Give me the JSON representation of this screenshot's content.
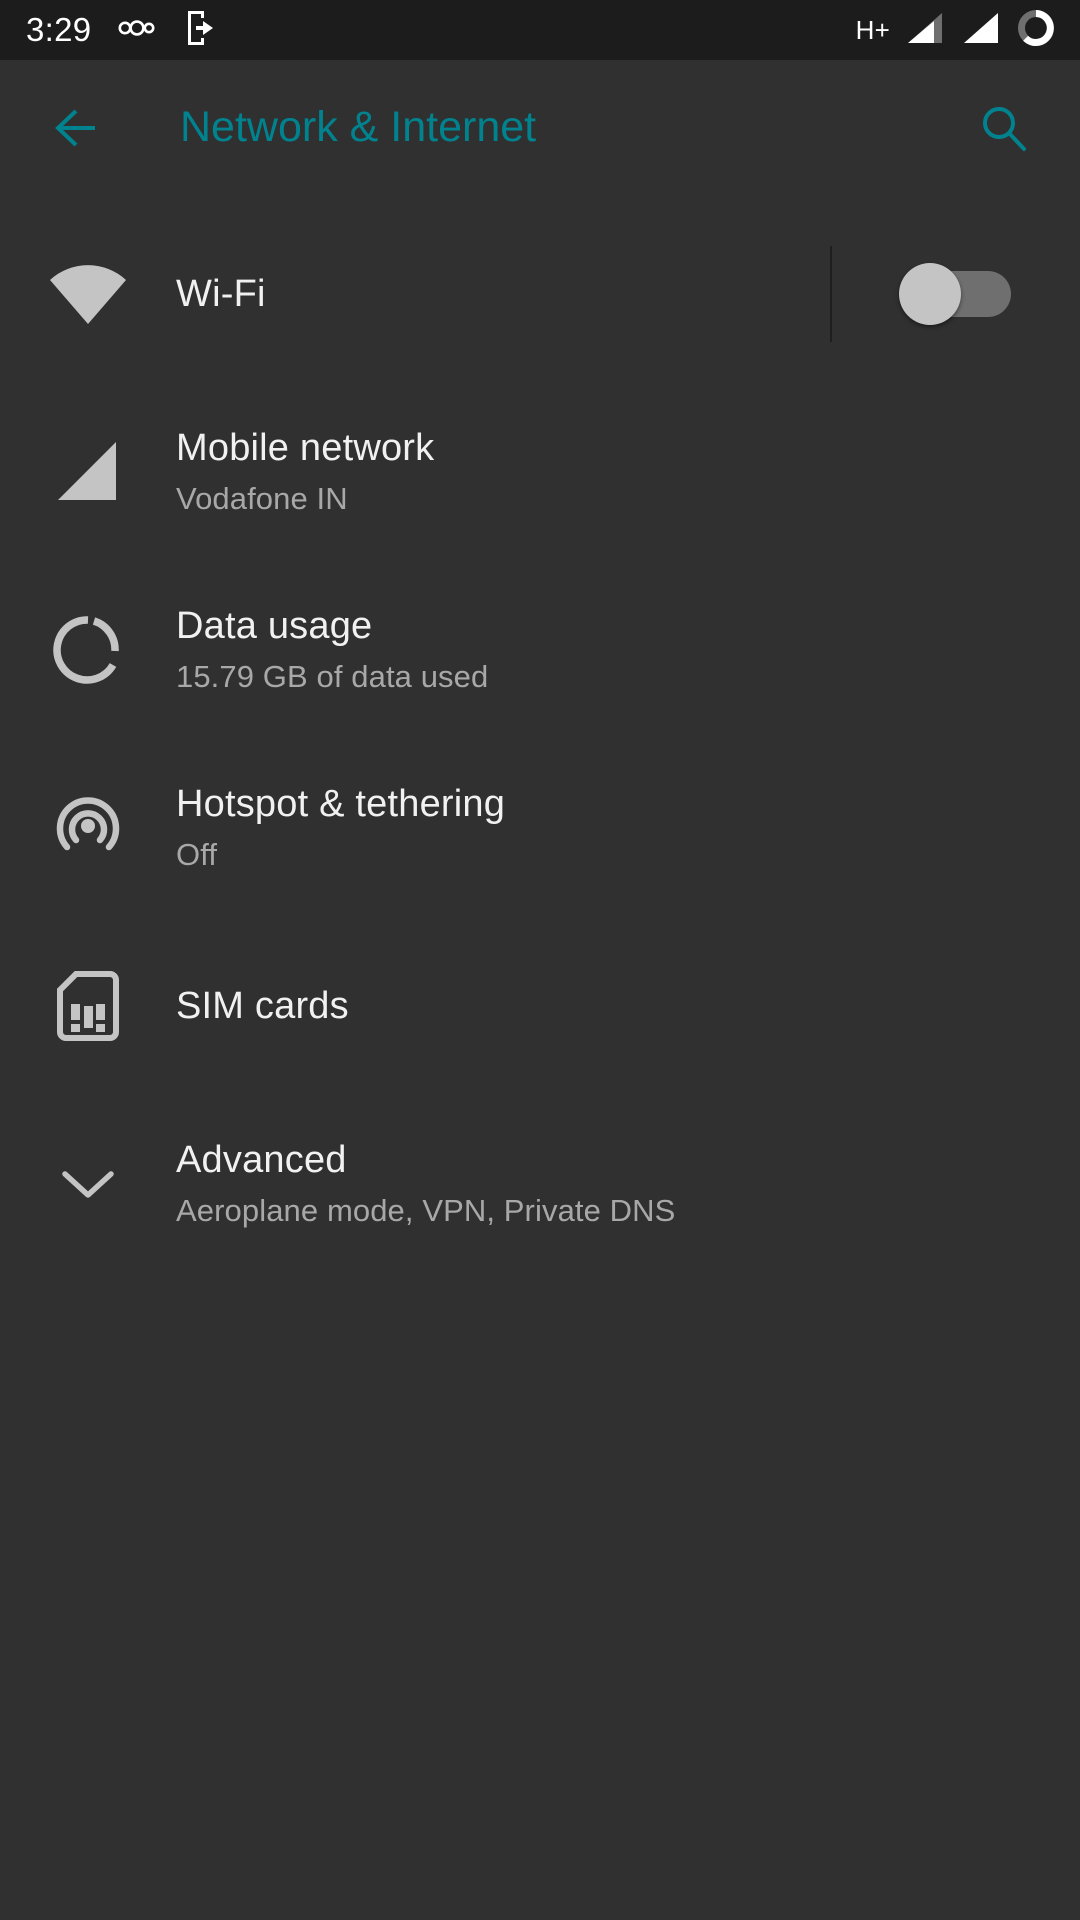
{
  "status_bar": {
    "clock": "3:29",
    "left_icons": [
      {
        "name": "lineageos-icon",
        "label": "LineageOS"
      },
      {
        "name": "exit-to-app-icon",
        "label": "Exit to app"
      }
    ],
    "network_type": "H+",
    "right_icons": [
      {
        "name": "signal-sim1-icon",
        "label": "Signal SIM 1"
      },
      {
        "name": "signal-sim2-icon",
        "label": "Signal SIM 2"
      },
      {
        "name": "battery-circle-icon",
        "label": "Battery",
        "percent": 60
      }
    ]
  },
  "app_bar": {
    "back_label": "Back",
    "title": "Network & Internet",
    "search_label": "Search",
    "accent_color": "#00838f"
  },
  "list": {
    "items": [
      {
        "icon": "wifi-icon",
        "title": "Wi-Fi",
        "subtitle": "",
        "has_toggle": true,
        "toggle_on": false
      },
      {
        "icon": "signal-cellular-icon",
        "title": "Mobile network",
        "subtitle": "Vodafone IN",
        "has_toggle": false
      },
      {
        "icon": "data-usage-icon",
        "title": "Data usage",
        "subtitle": "15.79 GB of data used",
        "has_toggle": false
      },
      {
        "icon": "hotspot-tethering-icon",
        "title": "Hotspot & tethering",
        "subtitle": "Off",
        "has_toggle": false
      },
      {
        "icon": "sim-card-icon",
        "title": "SIM cards",
        "subtitle": "",
        "has_toggle": false
      },
      {
        "icon": "chevron-down-icon",
        "title": "Advanced",
        "subtitle": "Aeroplane mode, VPN, Private DNS",
        "has_toggle": false
      }
    ]
  },
  "colors": {
    "background": "#303030",
    "status_bar_bg": "#1c1c1c",
    "accent": "#00838f",
    "primary_text": "#f1f1f1",
    "secondary_text": "#a8a8a8",
    "icon": "#c4c4c4"
  }
}
